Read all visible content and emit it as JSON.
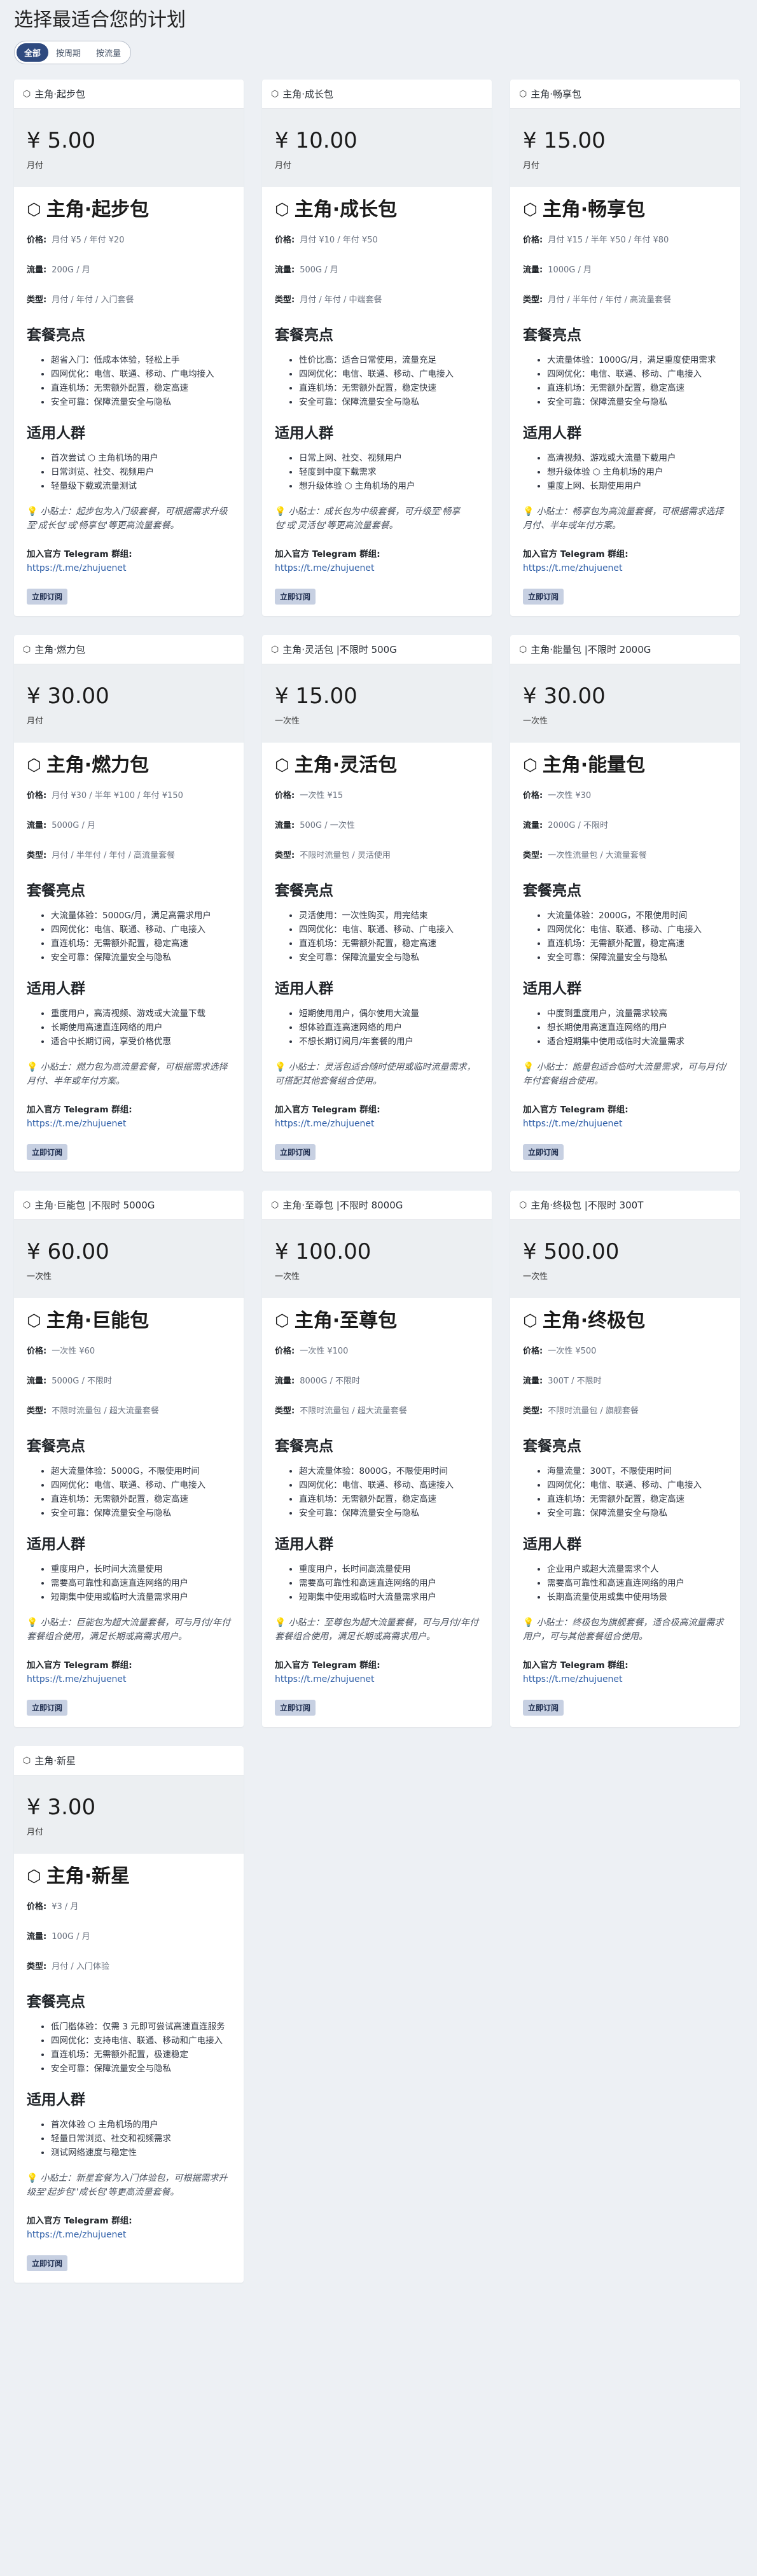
{
  "page": {
    "title": "选择最适合您的计划",
    "tabs": [
      "全部",
      "按周期",
      "按流量"
    ]
  },
  "labels": {
    "price": "价格:",
    "traffic": "流量:",
    "type": "类型:",
    "highlights": "套餐亮点",
    "audience": "适用人群",
    "join": "加入官方 Telegram 群组:",
    "link": "https://t.me/zhujuenet",
    "subscribe": "立即订阅",
    "icon_cube": "⬡",
    "icon_bulb": "💡"
  },
  "plans": [
    {
      "head": "主角·起步包",
      "price": "¥ 5.00",
      "period": "月付",
      "name": "主角·起步包",
      "price_detail": "月付 ¥5 / 年付 ¥20",
      "traffic": "200G / 月",
      "type": "月付 / 年付 / 入门套餐",
      "features": [
        "超省入门：低成本体验，轻松上手",
        "四网优化：电信、联通、移动、广电均接入",
        "直连机场：无需额外配置，稳定高速",
        "安全可靠：保障流量安全与隐私"
      ],
      "audience": [
        "首次尝试 ⬡ 主角机场的用户",
        "日常浏览、社交、视频用户",
        "轻量级下载或流量测试"
      ],
      "tip": "小贴士：起步包为入门级套餐，可根据需求升级至'成长包'或'畅享包'等更高流量套餐。"
    },
    {
      "head": "主角·成长包",
      "price": "¥ 10.00",
      "period": "月付",
      "name": "主角·成长包",
      "price_detail": "月付 ¥10 / 年付 ¥50",
      "traffic": "500G / 月",
      "type": "月付 / 年付 / 中端套餐",
      "features": [
        "性价比高：适合日常使用，流量充足",
        "四网优化：电信、联通、移动、广电接入",
        "直连机场：无需额外配置，稳定快速",
        "安全可靠：保障流量安全与隐私"
      ],
      "audience": [
        "日常上网、社交、视频用户",
        "轻度到中度下载需求",
        "想升级体验 ⬡ 主角机场的用户"
      ],
      "tip": "小贴士：成长包为中级套餐，可升级至'畅享包'或'灵活包'等更高流量套餐。"
    },
    {
      "head": "主角·畅享包",
      "price": "¥ 15.00",
      "period": "月付",
      "name": "主角·畅享包",
      "price_detail": "月付 ¥15 / 半年 ¥50 / 年付 ¥80",
      "traffic": "1000G / 月",
      "type": "月付 / 半年付 / 年付 / 高流量套餐",
      "features": [
        "大流量体验：1000G/月，满足重度使用需求",
        "四网优化：电信、联通、移动、广电接入",
        "直连机场：无需额外配置，稳定高速",
        "安全可靠：保障流量安全与隐私"
      ],
      "audience": [
        "高清视频、游戏或大流量下载用户",
        "想升级体验 ⬡ 主角机场的用户",
        "重度上网、长期使用用户"
      ],
      "tip": "小贴士：畅享包为高流量套餐，可根据需求选择月付、半年或年付方案。"
    },
    {
      "head": "主角·燃力包",
      "price": "¥ 30.00",
      "period": "月付",
      "name": "主角·燃力包",
      "price_detail": "月付 ¥30 / 半年 ¥100 / 年付 ¥150",
      "traffic": "5000G / 月",
      "type": "月付 / 半年付 / 年付 / 高流量套餐",
      "features": [
        "大流量体验：5000G/月，满足高需求用户",
        "四网优化：电信、联通、移动、广电接入",
        "直连机场：无需额外配置，稳定高速",
        "安全可靠：保障流量安全与隐私"
      ],
      "audience": [
        "重度用户，高清视频、游戏或大流量下载",
        "长期使用高速直连网络的用户",
        "适合中长期订阅，享受价格优惠"
      ],
      "tip": "小贴士：燃力包为高流量套餐，可根据需求选择月付、半年或年付方案。"
    },
    {
      "head": "主角·灵活包 |不限时 500G",
      "price": "¥ 15.00",
      "period": "一次性",
      "name": "主角·灵活包",
      "price_detail": "一次性 ¥15",
      "traffic": "500G / 一次性",
      "type": "不限时流量包 / 灵活使用",
      "features": [
        "灵活使用：一次性购买，用完结束",
        "四网优化：电信、联通、移动、广电接入",
        "直连机场：无需额外配置，稳定高速",
        "安全可靠：保障流量安全与隐私"
      ],
      "audience": [
        "短期使用用户，偶尔使用大流量",
        "想体验直连高速网络的用户",
        "不想长期订阅月/年套餐的用户"
      ],
      "tip": "小贴士：灵活包适合随时使用或临时流量需求，可搭配其他套餐组合使用。"
    },
    {
      "head": "主角·能量包 |不限时 2000G",
      "price": "¥ 30.00",
      "period": "一次性",
      "name": "主角·能量包",
      "price_detail": "一次性 ¥30",
      "traffic": "2000G / 不限时",
      "type": "一次性流量包 / 大流量套餐",
      "features": [
        "大流量体验：2000G，不限使用时间",
        "四网优化：电信、联通、移动、广电接入",
        "直连机场：无需额外配置，稳定高速",
        "安全可靠：保障流量安全与隐私"
      ],
      "audience": [
        "中度到重度用户，流量需求较高",
        "想长期使用高速直连网络的用户",
        "适合短期集中使用或临时大流量需求"
      ],
      "tip": "小贴士：能量包适合临时大流量需求，可与月付/年付套餐组合使用。"
    },
    {
      "head": "主角·巨能包 |不限时 5000G",
      "price": "¥ 60.00",
      "period": "一次性",
      "name": "主角·巨能包",
      "price_detail": "一次性 ¥60",
      "traffic": "5000G / 不限时",
      "type": "不限时流量包 / 超大流量套餐",
      "features": [
        "超大流量体验：5000G，不限使用时间",
        "四网优化：电信、联通、移动、广电接入",
        "直连机场：无需额外配置，稳定高速",
        "安全可靠：保障流量安全与隐私"
      ],
      "audience": [
        "重度用户，长时间大流量使用",
        "需要高可靠性和高速直连网络的用户",
        "短期集中使用或临时大流量需求用户"
      ],
      "tip": "小贴士：巨能包为超大流量套餐，可与月付/年付套餐组合使用，满足长期或高需求用户。"
    },
    {
      "head": "主角·至尊包 |不限时 8000G",
      "price": "¥ 100.00",
      "period": "一次性",
      "name": "主角·至尊包",
      "price_detail": "一次性 ¥100",
      "traffic": "8000G / 不限时",
      "type": "不限时流量包 / 超大流量套餐",
      "features": [
        "超大流量体验：8000G，不限使用时间",
        "四网优化：电信、联通、移动、高速接入",
        "直连机场：无需额外配置，稳定高速",
        "安全可靠：保障流量安全与隐私"
      ],
      "audience": [
        "重度用户，长时间高流量使用",
        "需要高可靠性和高速直连网络的用户",
        "短期集中使用或临时大流量需求用户"
      ],
      "tip": "小贴士：至尊包为超大流量套餐，可与月付/年付套餐组合使用，满足长期或高需求用户。"
    },
    {
      "head": "主角·终极包 |不限时 300T",
      "price": "¥ 500.00",
      "period": "一次性",
      "name": "主角·终极包",
      "price_detail": "一次性 ¥500",
      "traffic": "300T / 不限时",
      "type": "不限时流量包 / 旗舰套餐",
      "features": [
        "海量流量：300T，不限使用时间",
        "四网优化：电信、联通、移动、广电接入",
        "直连机场：无需额外配置，稳定高速",
        "安全可靠：保障流量安全与隐私"
      ],
      "audience": [
        "企业用户或超大流量需求个人",
        "需要高可靠性和高速直连网络的用户",
        "长期高流量使用或集中使用场景"
      ],
      "tip": "小贴士：终极包为旗舰套餐，适合极高流量需求用户，可与其他套餐组合使用。"
    },
    {
      "head": "主角·新星",
      "price": "¥ 3.00",
      "period": "月付",
      "name": "主角·新星",
      "price_detail": "¥3 / 月",
      "traffic": "100G / 月",
      "type": "月付 / 入门体验",
      "features": [
        "低门槛体验：仅需 3 元即可尝试高速直连服务",
        "四网优化：支持电信、联通、移动和广电接入",
        "直连机场：无需额外配置，极速稳定",
        "安全可靠：保障流量安全与隐私"
      ],
      "audience": [
        "首次体验 ⬡ 主角机场的用户",
        "轻量日常浏览、社交和视频需求",
        "测试网络速度与稳定性"
      ],
      "tip": "小贴士：新星套餐为入门体验包，可根据需求升级至'起步包''成长包'等更高流量套餐。"
    }
  ]
}
